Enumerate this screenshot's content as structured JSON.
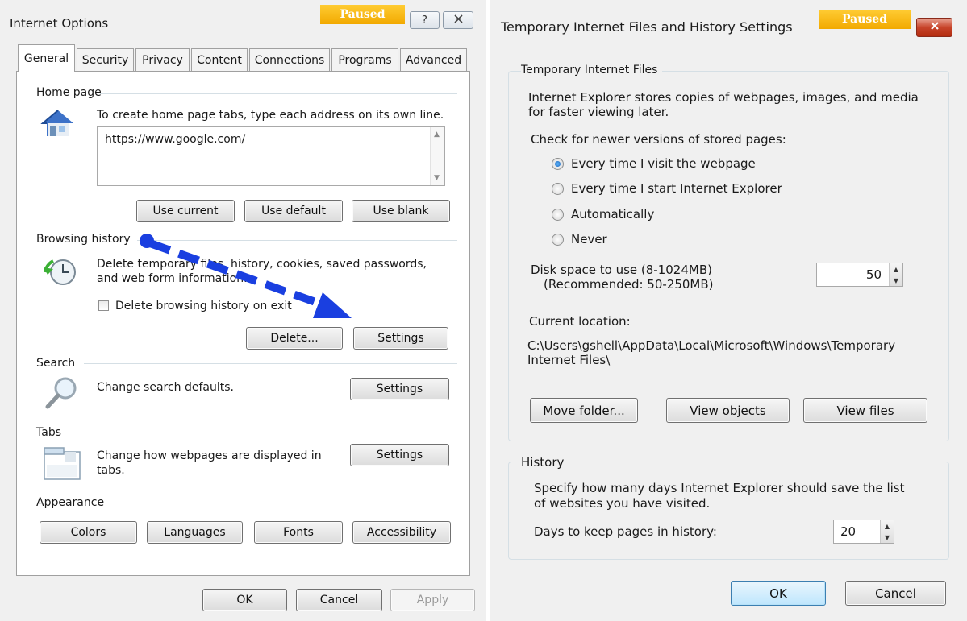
{
  "colors": {
    "accent": "#1a3fe0",
    "paused": "#f5b200",
    "close": "#c7442a"
  },
  "left": {
    "title": "Internet Options",
    "paused": "Paused",
    "help_glyph": "?",
    "tabs": [
      "General",
      "Security",
      "Privacy",
      "Content",
      "Connections",
      "Programs",
      "Advanced"
    ],
    "home": {
      "label": "Home page",
      "desc": "To create home page tabs, type each address on its own line.",
      "url": "https://www.google.com/",
      "use_current": "Use current",
      "use_default": "Use default",
      "use_blank": "Use blank"
    },
    "history": {
      "label": "Browsing history",
      "desc1": "Delete temporary files, history, cookies, saved passwords,",
      "desc2": "and web form information.",
      "checkbox": "Delete browsing history on exit",
      "delete": "Delete...",
      "settings": "Settings"
    },
    "search": {
      "label": "Search",
      "desc": "Change search defaults.",
      "settings": "Settings"
    },
    "tabs_group": {
      "label": "Tabs",
      "desc1": "Change how webpages are displayed in",
      "desc2": "tabs.",
      "settings": "Settings"
    },
    "appearance": {
      "label": "Appearance",
      "colors": "Colors",
      "languages": "Languages",
      "fonts": "Fonts",
      "accessibility": "Accessibility"
    },
    "ok": "OK",
    "cancel": "Cancel",
    "apply": "Apply"
  },
  "right": {
    "title": "Temporary Internet Files and History Settings",
    "paused": "Paused",
    "temp": {
      "label": "Temporary Internet Files",
      "desc1": "Internet Explorer stores copies of webpages, images, and media",
      "desc2": "for faster viewing later.",
      "check_label": "Check for newer versions of stored pages:",
      "options": [
        "Every time I visit the webpage",
        "Every time I start Internet Explorer",
        "Automatically",
        "Never"
      ],
      "selected_index": 0,
      "disk_label1": "Disk space to use (8-1024MB)",
      "disk_label2": "(Recommended: 50-250MB)",
      "disk_value": "50",
      "loc_label": "Current location:",
      "loc_path1": "C:\\Users\\gshell\\AppData\\Local\\Microsoft\\Windows\\Temporary",
      "loc_path2": "Internet Files\\",
      "move_folder": "Move folder...",
      "view_objects": "View objects",
      "view_files": "View files"
    },
    "history": {
      "label": "History",
      "desc1": "Specify how many days Internet Explorer should save the list",
      "desc2": "of websites you have visited.",
      "days_label": "Days to keep pages in history:",
      "days_value": "20"
    },
    "ok": "OK",
    "cancel": "Cancel"
  }
}
